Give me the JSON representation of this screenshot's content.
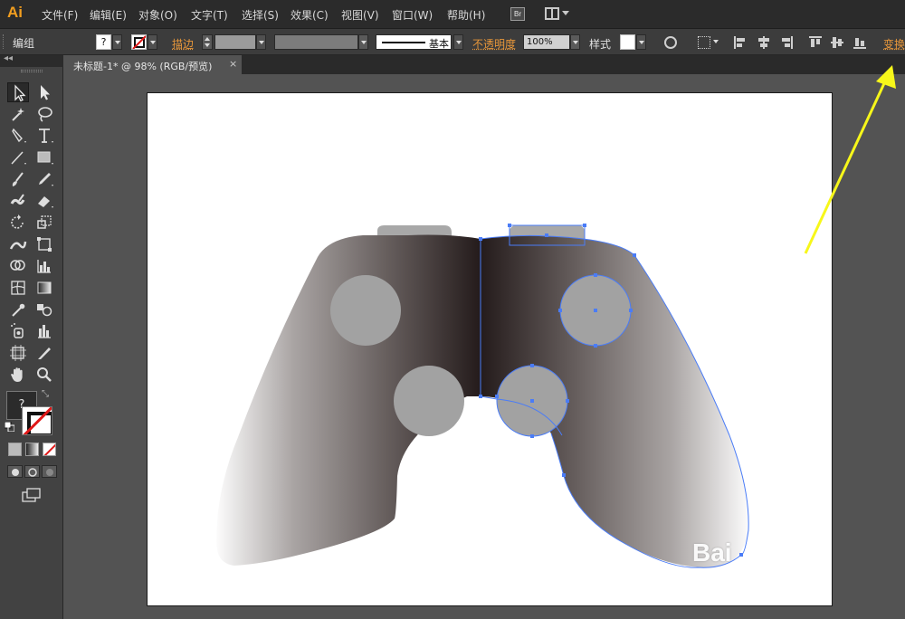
{
  "app": {
    "logo": "Ai"
  },
  "menu": [
    "文件(F)",
    "编辑(E)",
    "对象(O)",
    "文字(T)",
    "选择(S)",
    "效果(C)",
    "视图(V)",
    "窗口(W)",
    "帮助(H)"
  ],
  "bridge_label": "Br",
  "control": {
    "selection_type": "编组",
    "fill_value": "?",
    "stroke_label": "描边",
    "stroke_profile": "基本",
    "opacity_label": "不透明度",
    "opacity_value": "100%",
    "style_label": "样式",
    "transform_label": "变换"
  },
  "document": {
    "tab_title": "未标题-1* @ 98% (RGB/预览)",
    "close": "×"
  },
  "tools": {
    "collapse": "◂◂",
    "fill_question": "?",
    "items": [
      "selection-tool",
      "direct-selection-tool",
      "magic-wand-tool",
      "lasso-tool",
      "pen-tool",
      "type-tool",
      "line-segment-tool",
      "rectangle-tool",
      "paintbrush-tool",
      "pencil-tool",
      "blob-brush-tool",
      "eraser-tool",
      "rotate-tool",
      "scale-tool",
      "warp-tool",
      "free-transform-tool",
      "shape-builder-tool",
      "column-graph-tool",
      "mesh-tool",
      "gradient-tool",
      "eyedropper-tool",
      "blend-tool",
      "symbol-sprayer-tool",
      "column-graph-tool-2",
      "artboard-tool",
      "slice-tool",
      "hand-tool",
      "zoom-tool"
    ]
  },
  "watermark": "Bai",
  "colors": {
    "accent": "#e8973a",
    "selection": "#4a7cf7",
    "annotation_arrow": "#f7f71a"
  }
}
